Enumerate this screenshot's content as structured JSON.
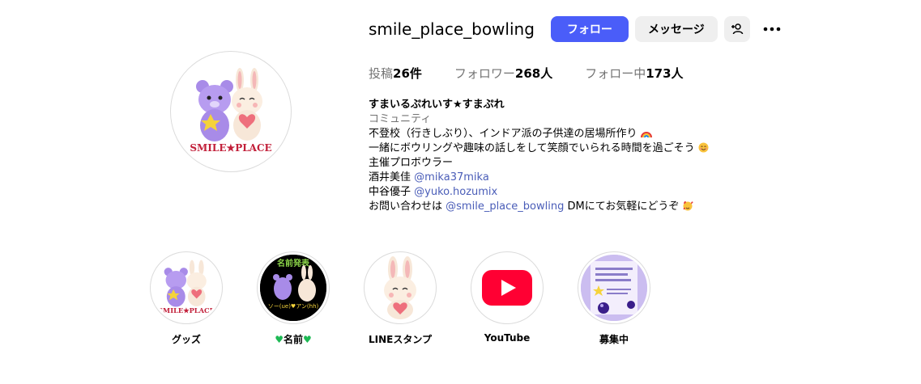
{
  "profile": {
    "username": "smile_place_bowling",
    "avatar_brand": "SMILE★PLACE",
    "follow_label": "フォロー",
    "message_label": "メッセージ",
    "add_user_icon": "person-plus-icon",
    "more_icon": "more-horizontal-icon"
  },
  "stats": {
    "posts_label": "投稿",
    "posts_count": "26件",
    "followers_label": "フォロワー",
    "followers_count": "268人",
    "following_label": "フォロー中",
    "following_count": "173人"
  },
  "bio": {
    "display_name": "すまいるぷれいす★すまぷれ",
    "category": "コミュニティ",
    "line1": "不登校（行きしぶり）、インドア派の子供達の居場所作り",
    "line2": "一緒にボウリングや趣味の話しをして笑顔でいられる時間を過ごそう",
    "line3": "主催プロボウラー",
    "line4_name": "酒井美佳",
    "line4_mention": "@mika37mika",
    "line5_name": "中谷優子",
    "line5_mention": "@yuko.hozumix",
    "line6_prefix": "お問い合わせは",
    "line6_mention": "@smile_place_bowling",
    "line6_suffix": "DMにてお気軽にどうぞ"
  },
  "highlights": [
    {
      "label": "グッズ",
      "brand_text": "SMILE★PLACE"
    },
    {
      "label": "名前",
      "top_text": "名前発表",
      "bottom_text": "ソー(ue)♥アン(hh)"
    },
    {
      "label": "LINEスタンプ"
    },
    {
      "label": "YouTube"
    },
    {
      "label": "募集中"
    }
  ],
  "colors": {
    "primary_button": "#4a5df9",
    "secondary_button": "#efefef",
    "link": "#4a5db8",
    "muted_text": "#737373",
    "youtube_red": "#ff0033",
    "heart_green": "#1db954"
  }
}
